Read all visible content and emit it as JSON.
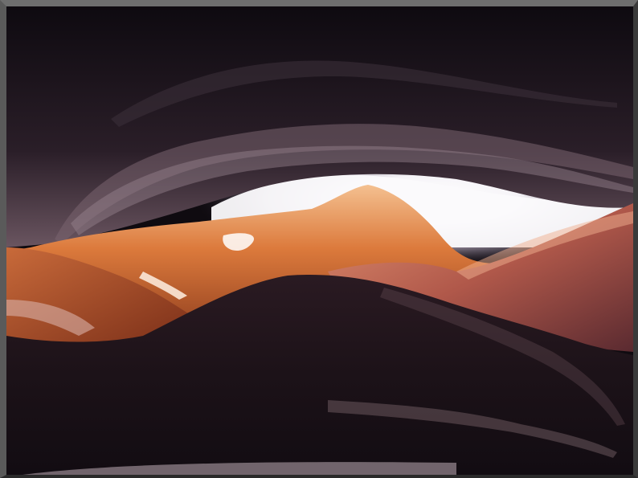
{
  "scene": {
    "subject": "slot-canyon-photo",
    "colors": {
      "dark_rock": "#120c12",
      "mid_rock": "#3a2025",
      "warm_rock": "#c8602a",
      "glow_rock": "#f0a060",
      "sky_light": "#ffffff",
      "frame_light": "#6e6e6e",
      "frame_dark": "#2a2a2a"
    }
  }
}
